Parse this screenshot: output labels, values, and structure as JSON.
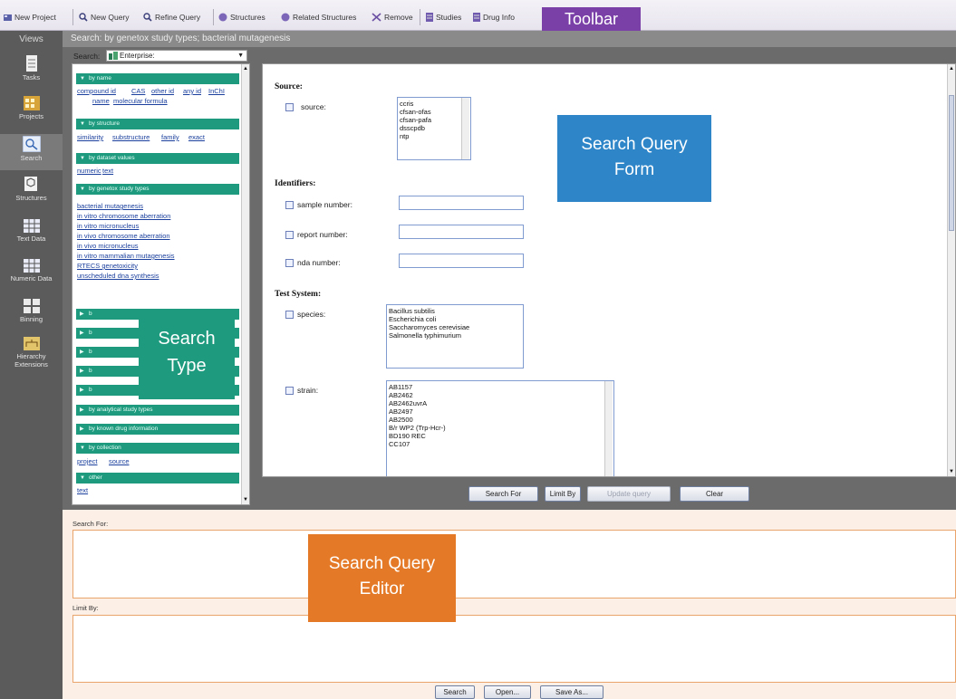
{
  "toolbar": {
    "new_project": "New Project",
    "new_query": "New Query",
    "refine_query": "Refine Query",
    "structures": "Structures",
    "related_structures": "Related Structures",
    "remove": "Remove",
    "studies": "Studies",
    "drug_info": "Drug Info",
    "badge": "Toolbar",
    "badge_color": "#7b3fa8"
  },
  "views": {
    "title": "Views",
    "items": [
      {
        "label": "Tasks",
        "icon": "tasks-icon"
      },
      {
        "label": "Projects",
        "icon": "projects-icon"
      },
      {
        "label": "Search",
        "icon": "search-icon"
      },
      {
        "label": "Structures",
        "icon": "structures-icon"
      },
      {
        "label": "Text Data",
        "icon": "text-data-icon"
      },
      {
        "label": "Numeric Data",
        "icon": "numeric-data-icon"
      },
      {
        "label": "Binning",
        "icon": "binning-icon"
      },
      {
        "label": "Hierarchy Extensions",
        "icon": "hierarchy-icon"
      }
    ]
  },
  "header": {
    "title": "Search: by genetox study types; bacterial mutagenesis"
  },
  "search_type": {
    "search_label": "Search:",
    "selected": "Enterprise:",
    "by_name": {
      "label": "by name",
      "links": [
        "compound id",
        "CAS",
        "other id",
        "any id",
        "InChI",
        "name",
        "molecular formula"
      ]
    },
    "by_structure": {
      "label": "by structure",
      "links": [
        "similarity",
        "substructure",
        "family",
        "exact"
      ]
    },
    "by_dataset": {
      "label": "by dataset values",
      "links": [
        "numeric",
        "text"
      ]
    },
    "by_genetox": {
      "label": "by genetox study types",
      "links": [
        "bacterial mutagenesis",
        "in vitro chromosome aberration",
        "in vitro micronucleus",
        "in vivo chromosome aberration",
        "in vivo micronucleus",
        "in vitro mammalian mutagenesis",
        "RTECS genetoxicity",
        "unscheduled dna synthesis"
      ]
    },
    "collapsed_marker": "b",
    "by_analytical": "by analytical study types",
    "by_known_drug": "by known drug information",
    "by_collection": {
      "label": "by collection",
      "links": [
        "project",
        "source"
      ]
    },
    "other": {
      "label": "other",
      "links": [
        "text"
      ]
    },
    "overlay_line1": "Search",
    "overlay_line2": "Type",
    "overlay_color": "#1e9a7e"
  },
  "form": {
    "source_section": "Source:",
    "source_label": "source:",
    "source_options": [
      "ccris",
      "cfsan-ofas",
      "cfsan-pafa",
      "dsscpdb",
      "ntp"
    ],
    "identifiers_section": "Identifiers:",
    "sample_number_label": "sample number:",
    "report_number_label": "report number:",
    "nda_number_label": "nda number:",
    "test_system_section": "Test System:",
    "species_label": "species:",
    "species_options": [
      "Bacillus subtilis",
      "Escherichia coli",
      "Saccharomyces cerevisiae",
      "Salmonella typhimurium"
    ],
    "strain_label": "strain:",
    "strain_options": [
      "AB1157",
      "AB2462",
      "AB2462uvrA",
      "AB2497",
      "AB2500",
      "B/r WP2 (Trp-Hcr-)",
      "BD190 REC",
      "CC107"
    ],
    "overlay_line1": "Search Query",
    "overlay_line2": "Form",
    "overlay_color": "#2e86c9"
  },
  "actions": {
    "search_for": "Search For",
    "limit_by": "Limit By",
    "update_query": "Update query",
    "clear": "Clear"
  },
  "editor": {
    "search_for_label": "Search For:",
    "limit_by_label": "Limit By:",
    "overlay_line1": "Search Query",
    "overlay_line2": "Editor",
    "overlay_color": "#e47a28",
    "search": "Search",
    "open": "Open...",
    "save_as": "Save As..."
  }
}
